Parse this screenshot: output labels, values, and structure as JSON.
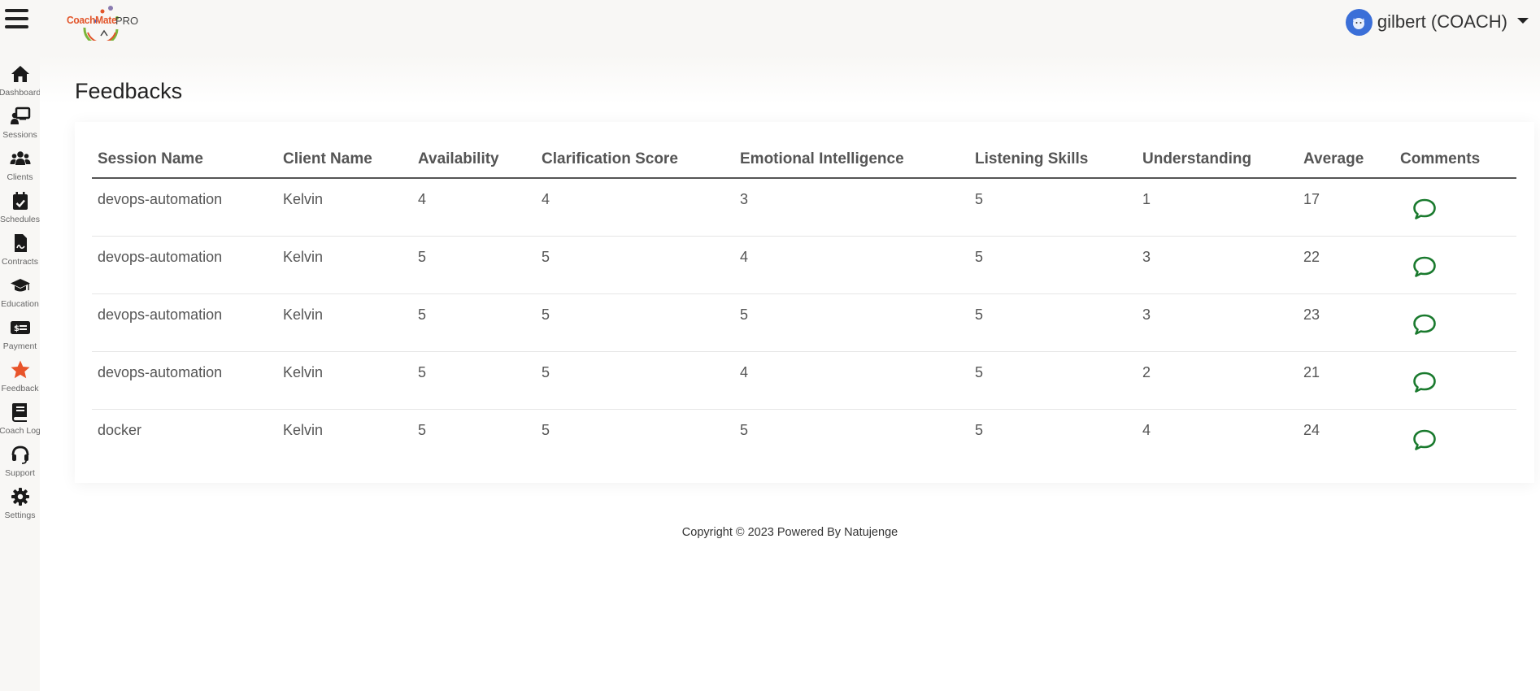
{
  "header": {
    "logo_coach": "CoachMate",
    "logo_pro": "PRO",
    "user_name": "gilbert (COACH)",
    "icons": [
      "menu-icon",
      "avatar-icon",
      "caret-down-icon"
    ]
  },
  "sidebar": {
    "items": [
      {
        "label": "Dashboard",
        "icon": "home-icon"
      },
      {
        "label": "Sessions",
        "icon": "sessions-icon"
      },
      {
        "label": "Clients",
        "icon": "users-icon"
      },
      {
        "label": "Schedules",
        "icon": "calendar-check-icon"
      },
      {
        "label": "Contracts",
        "icon": "contract-icon"
      },
      {
        "label": "Education",
        "icon": "graduation-cap-icon"
      },
      {
        "label": "Payment",
        "icon": "payment-icon"
      },
      {
        "label": "Feedback",
        "icon": "star-icon",
        "active": true,
        "color": "#e8542a"
      },
      {
        "label": "Coach Log",
        "icon": "book-icon"
      },
      {
        "label": "Support",
        "icon": "headset-icon"
      },
      {
        "label": "Settings",
        "icon": "gear-icon"
      }
    ]
  },
  "main": {
    "title": "Feedbacks",
    "table": {
      "columns": [
        "Session Name",
        "Client Name",
        "Availability",
        "Clarification Score",
        "Emotional Intelligence",
        "Listening Skills",
        "Understanding",
        "Average",
        "Comments"
      ],
      "rows": [
        [
          "devops-automation",
          "Kelvin",
          "4",
          "4",
          "3",
          "5",
          "1",
          "17"
        ],
        [
          "devops-automation",
          "Kelvin",
          "5",
          "5",
          "4",
          "5",
          "3",
          "22"
        ],
        [
          "devops-automation",
          "Kelvin",
          "5",
          "5",
          "5",
          "5",
          "3",
          "23"
        ],
        [
          "devops-automation",
          "Kelvin",
          "5",
          "5",
          "4",
          "5",
          "2",
          "21"
        ],
        [
          "docker",
          "Kelvin",
          "5",
          "5",
          "5",
          "5",
          "4",
          "24"
        ]
      ],
      "comment_icon": "comment-icon",
      "comment_color": "#1a7a2e"
    }
  },
  "footer": {
    "text": "Copyright © 2023 Powered By Natujenge"
  },
  "colors": {
    "accent": "#e8542a",
    "sidebar_bg": "#f8f7f5",
    "comment": "#1a7a2e"
  }
}
